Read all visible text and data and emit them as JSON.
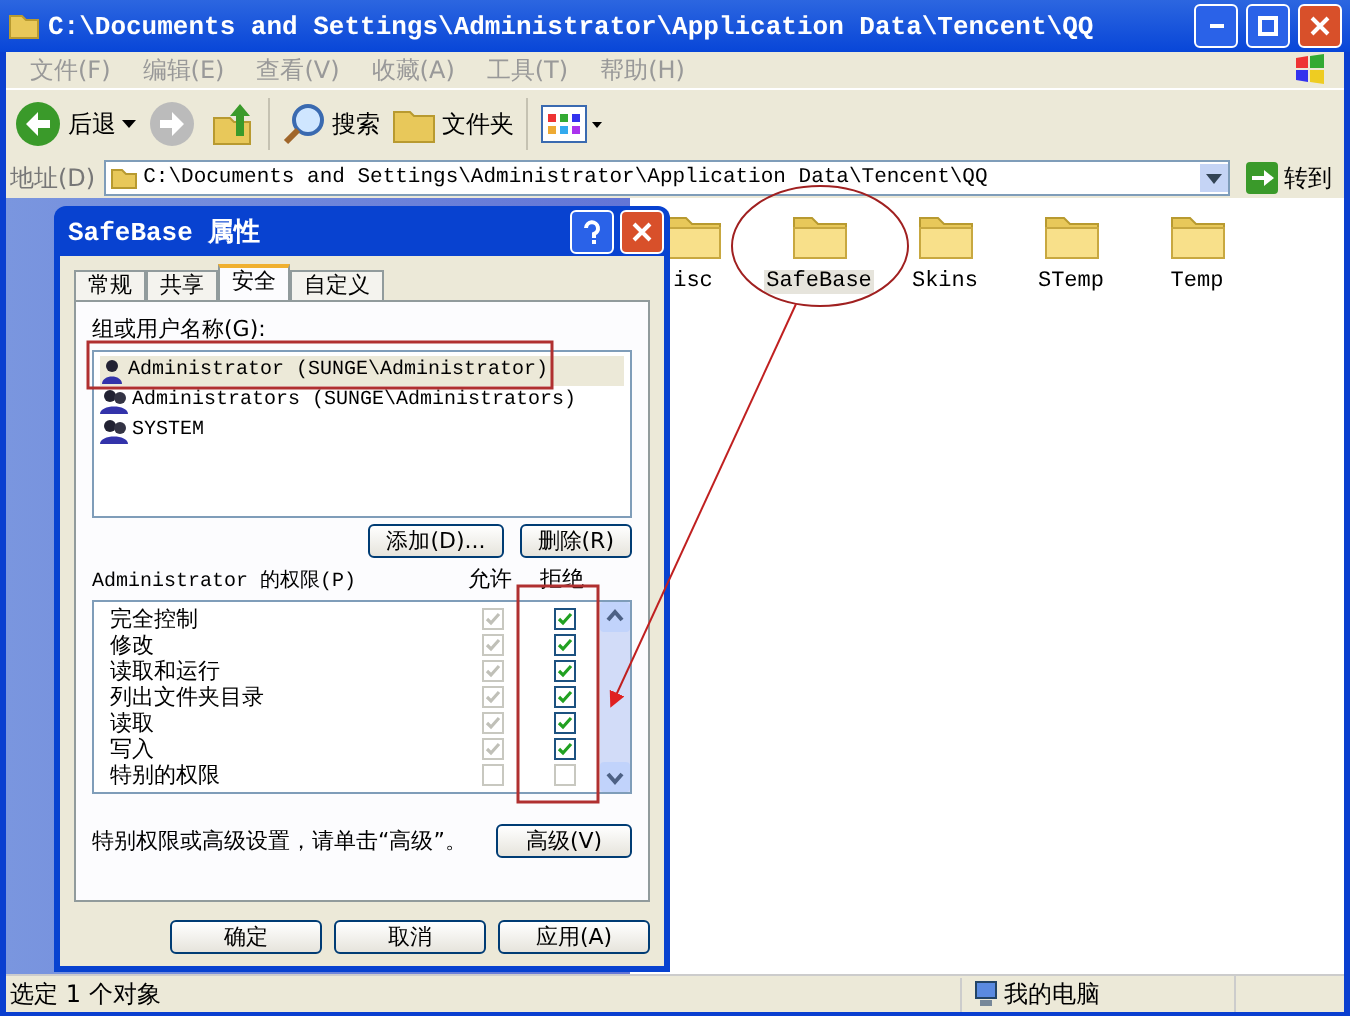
{
  "window": {
    "title": "C:\\Documents and Settings\\Administrator\\Application Data\\Tencent\\QQ"
  },
  "menu": [
    "文件(F)",
    "编辑(E)",
    "查看(V)",
    "收藏(A)",
    "工具(T)",
    "帮助(H)"
  ],
  "toolbar": [
    {
      "kind": "back",
      "label": "后退"
    },
    {
      "kind": "forward"
    },
    {
      "kind": "up"
    },
    {
      "kind": "search",
      "label": "搜索"
    },
    {
      "kind": "folders",
      "label": "文件夹"
    },
    {
      "kind": "views"
    }
  ],
  "address": {
    "label": "地址(D)",
    "value": "C:\\Documents and Settings\\Administrator\\Application Data\\Tencent\\QQ",
    "go": "转到"
  },
  "folders": [
    {
      "name": "isc",
      "selected": false
    },
    {
      "name": "SafeBase",
      "selected": true
    },
    {
      "name": "Skins",
      "selected": false
    },
    {
      "name": "STemp",
      "selected": false
    },
    {
      "name": "Temp",
      "selected": false
    }
  ],
  "status_bar": {
    "text": "选定 1 个对象",
    "location": "我的电脑"
  },
  "dialog": {
    "title": "SafeBase 属性",
    "tabs": [
      {
        "label": "常规",
        "selected": false
      },
      {
        "label": "共享",
        "selected": false
      },
      {
        "label": "安全",
        "selected": true
      },
      {
        "label": "自定义",
        "selected": false
      }
    ],
    "users_label": "组或用户名称(G):",
    "users": [
      {
        "name": "Administrator (SUNGE\\Administrator)",
        "kind": "user",
        "selected": true
      },
      {
        "name": "Administrators (SUNGE\\Administrators)",
        "kind": "group",
        "selected": false
      },
      {
        "name": "SYSTEM",
        "kind": "group",
        "selected": false
      }
    ],
    "add_button": "添加(D)...",
    "remove_button": "删除(R)",
    "permissions_label": "Administrator 的权限(P)",
    "allow_header": "允许",
    "deny_header": "拒绝",
    "allow_disabled": true,
    "permissions": [
      {
        "name": "完全控制",
        "allow": true,
        "deny": true
      },
      {
        "name": "修改",
        "allow": true,
        "deny": true
      },
      {
        "name": "读取和运行",
        "allow": true,
        "deny": true
      },
      {
        "name": "列出文件夹目录",
        "allow": true,
        "deny": true
      },
      {
        "name": "读取",
        "allow": true,
        "deny": true
      },
      {
        "name": "写入",
        "allow": true,
        "deny": true
      },
      {
        "name": "特别的权限",
        "allow": false,
        "deny": false
      }
    ],
    "advanced_note": "特别权限或高级设置，请单击“高级”。",
    "advanced_button": "高级(V)",
    "buttons": [
      "确定",
      "取消",
      "应用(A)"
    ]
  }
}
